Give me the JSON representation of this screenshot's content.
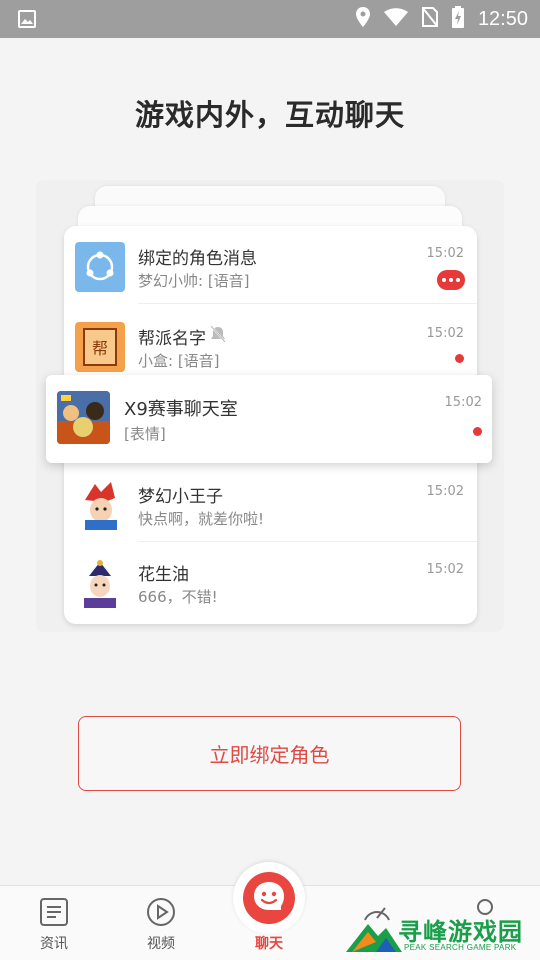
{
  "status_bar": {
    "time": "12:50",
    "icons": [
      "image-icon",
      "location-icon",
      "wifi-icon",
      "no-sim-icon",
      "battery-charging-icon"
    ]
  },
  "headline": "游戏内外，互动聊天",
  "chat_list": [
    {
      "name": "绑定的角色消息",
      "preview": "梦幻小帅: [语音]",
      "time": "15:02",
      "indicator": "more-badge",
      "avatar": "share-icon"
    },
    {
      "name": "帮派名字",
      "preview": "小盒: [语音]",
      "time": "15:02",
      "indicator": "dot",
      "avatar": "guild-icon",
      "avatar_text": "帮",
      "muted": true
    },
    {
      "name": "梦幻小王子",
      "preview": "快点啊，就差你啦!",
      "time": "15:02",
      "indicator": "none",
      "avatar": "character-avatar"
    },
    {
      "name": "花生油",
      "preview": "666，不错!",
      "time": "15:02",
      "indicator": "none",
      "avatar": "character-avatar"
    }
  ],
  "featured_chat": {
    "name": "X9赛事聊天室",
    "preview": "[表情]",
    "time": "15:02",
    "indicator": "dot"
  },
  "bind_button": {
    "label": "立即绑定角色"
  },
  "tabbar": {
    "tabs": [
      {
        "label": "资讯",
        "icon": "news-icon"
      },
      {
        "label": "视频",
        "icon": "play-icon"
      },
      {
        "label": "聊天",
        "icon": "chat-icon",
        "active": true
      }
    ]
  },
  "watermark": {
    "title": "寻峰游戏园",
    "subtitle": "PEAK SEARCH GAME PARK"
  },
  "colors": {
    "accent": "#e8463f",
    "status_bar": "#9e9e9e",
    "watermark": "#1a9e4a"
  }
}
